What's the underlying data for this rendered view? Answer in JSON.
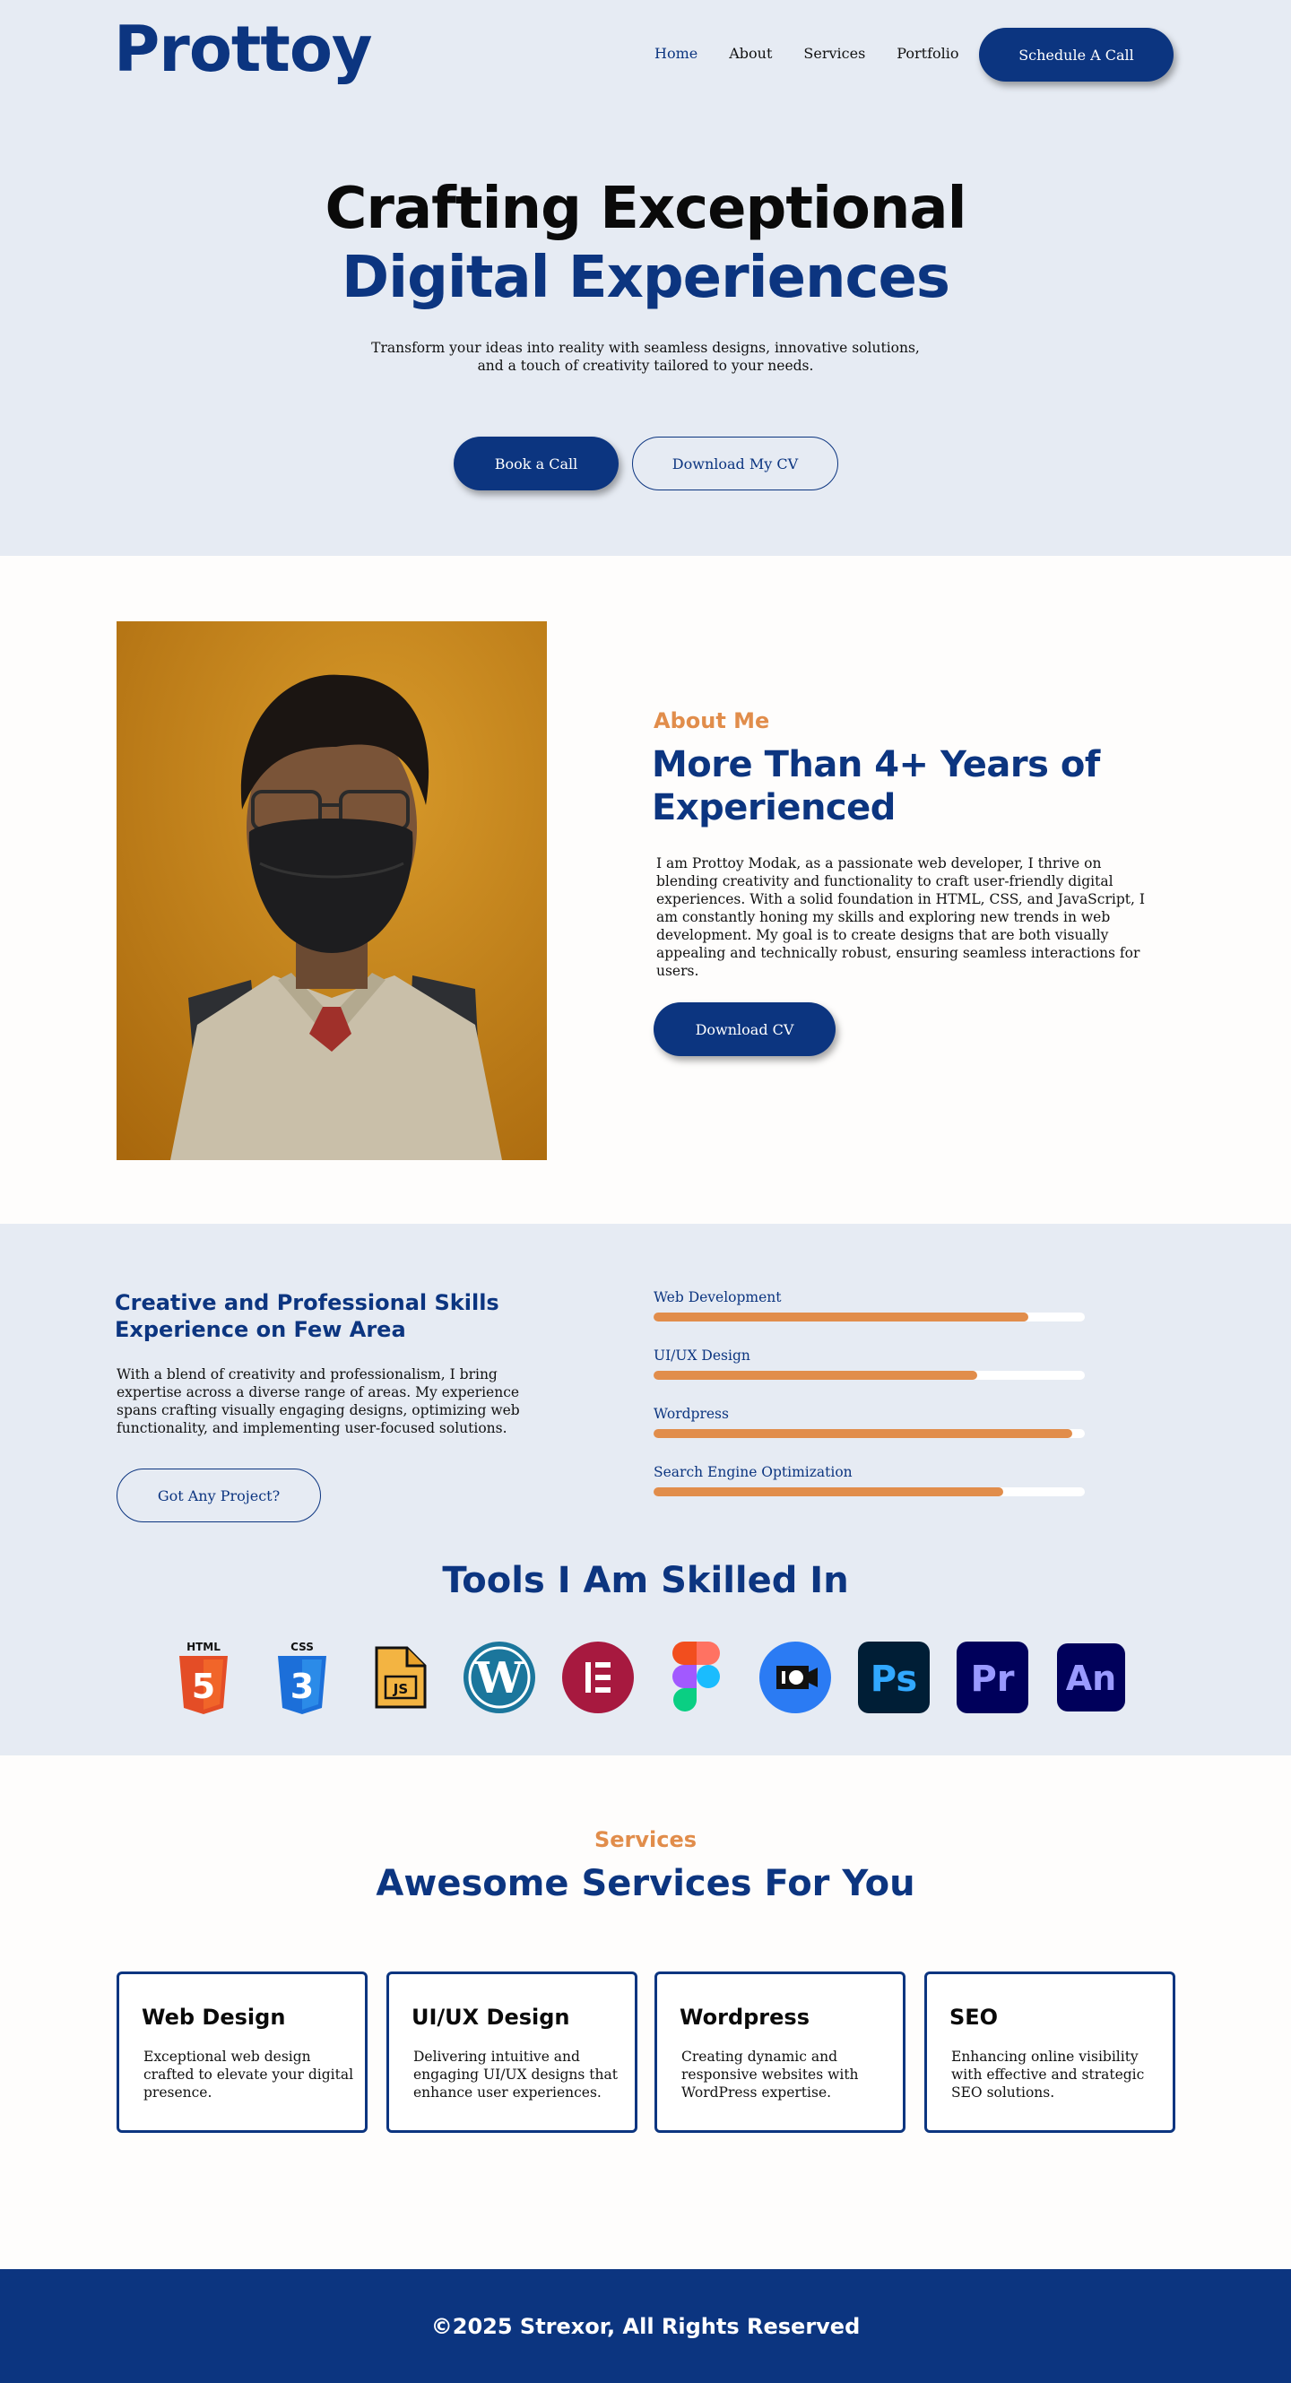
{
  "header": {
    "logo": "Prottoy",
    "nav": [
      {
        "label": "Home",
        "active": true
      },
      {
        "label": "About",
        "active": false
      },
      {
        "label": "Services",
        "active": false
      },
      {
        "label": "Portfolio",
        "active": false
      }
    ],
    "cta": "Schedule A Call"
  },
  "hero": {
    "title_line1": "Crafting Exceptional",
    "title_line2": "Digital Experiences",
    "subtitle": "Transform your ideas into reality with seamless designs, innovative solutions, and a touch of creativity tailored to your needs.",
    "primary_button": "Book a Call",
    "secondary_button": "Download My CV"
  },
  "about": {
    "kicker": "About Me",
    "heading": "More Than 4+ Years of Experienced",
    "body": "I am Prottoy Modak, as a passionate web developer, I thrive on blending creativity and functionality to craft user-friendly digital experiences. With a solid foundation in HTML, CSS, and JavaScript, I am constantly honing my skills and exploring new trends in web development. My goal is to create designs that are both visually appealing and technically robust, ensuring seamless interactions for users.",
    "button": "Download CV"
  },
  "skills": {
    "heading": "Creative and Professional Skills Experience on Few Area",
    "body": "With a blend of creativity and professionalism, I bring expertise across a diverse range of areas. My experience spans crafting visually engaging designs, optimizing web functionality, and implementing user-focused solutions.",
    "button": "Got Any Project?",
    "bars": [
      {
        "label": "Web Development",
        "level": 0.87
      },
      {
        "label": "UI/UX Design",
        "level": 0.75
      },
      {
        "label": "Wordpress",
        "level": 0.97
      },
      {
        "label": "Search Engine Optimization",
        "level": 0.81
      }
    ]
  },
  "tools": {
    "heading": "Tools I Am Skilled In",
    "items": [
      {
        "icon": "html5-icon",
        "badge": "HTML",
        "glyph": "5",
        "color": "#e44d26"
      },
      {
        "icon": "css3-icon",
        "badge": "CSS",
        "glyph": "3",
        "color": "#1c6fd9"
      },
      {
        "icon": "javascript-file-icon",
        "glyph": "JS",
        "color": "#f3b442"
      },
      {
        "icon": "wordpress-icon",
        "glyph": "W",
        "color": "#1b769c"
      },
      {
        "icon": "elementor-icon",
        "glyph": "E",
        "color": "#a7193f"
      },
      {
        "icon": "figma-icon",
        "color": "#0acf83"
      },
      {
        "icon": "screencast-icon",
        "color": "#2b7bf3"
      },
      {
        "icon": "photoshop-icon",
        "glyph": "Ps",
        "color": "#31a8ff"
      },
      {
        "icon": "premiere-icon",
        "glyph": "Pr",
        "color": "#9999ff"
      },
      {
        "icon": "animate-icon",
        "glyph": "An",
        "color": "#9a9aff"
      }
    ]
  },
  "services": {
    "kicker": "Services",
    "heading": "Awesome Services For You",
    "cards": [
      {
        "title": "Web Design",
        "body": "Exceptional web design crafted to elevate your digital presence."
      },
      {
        "title": "UI/UX Design",
        "body": "Delivering intuitive and engaging UI/UX designs that enhance user experiences."
      },
      {
        "title": "Wordpress",
        "body": "Creating dynamic and responsive websites with WordPress expertise."
      },
      {
        "title": "SEO",
        "body": "Enhancing online visibility with effective and strategic SEO solutions."
      }
    ]
  },
  "footer": {
    "text": "©2025 Strexor, All Rights Reserved"
  },
  "colors": {
    "navy": "#0c3580",
    "accent": "#e18d4b",
    "section_bg": "#e6ebf3"
  }
}
